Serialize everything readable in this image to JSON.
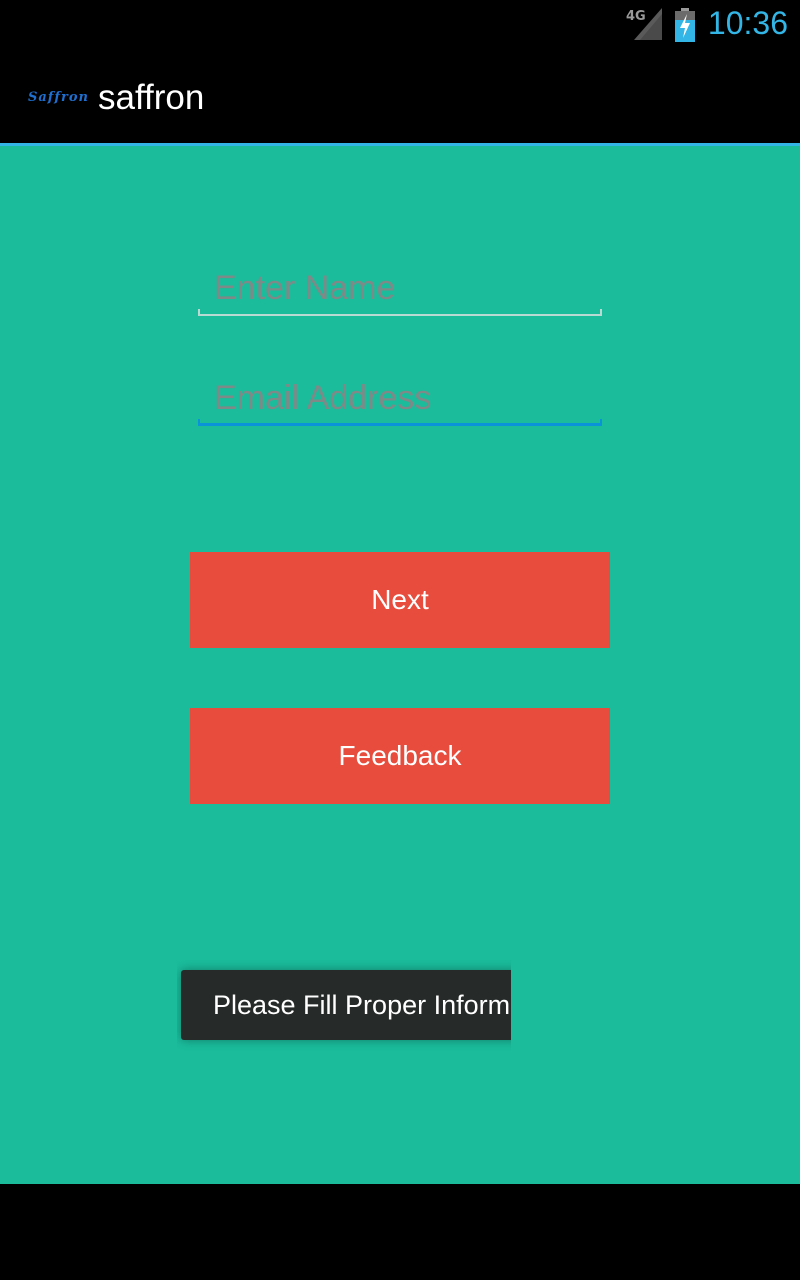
{
  "status_bar": {
    "network_label": "4G",
    "time": "10:36",
    "signal_icon": "signal-icon",
    "battery_icon": "battery-charging-icon"
  },
  "action_bar": {
    "logo_text": "Saffron",
    "title": "saffron"
  },
  "form": {
    "name_placeholder": "Enter Name",
    "name_value": "",
    "email_placeholder": "Email Address",
    "email_value": ""
  },
  "buttons": {
    "next_label": "Next",
    "feedback_label": "Feedback"
  },
  "toast": {
    "message": "Please Fill Proper Inform"
  },
  "colors": {
    "background": "#1abc9c",
    "button": "#e74c3c",
    "accent": "#33b5e5",
    "focus_underline": "#0a93d8"
  }
}
